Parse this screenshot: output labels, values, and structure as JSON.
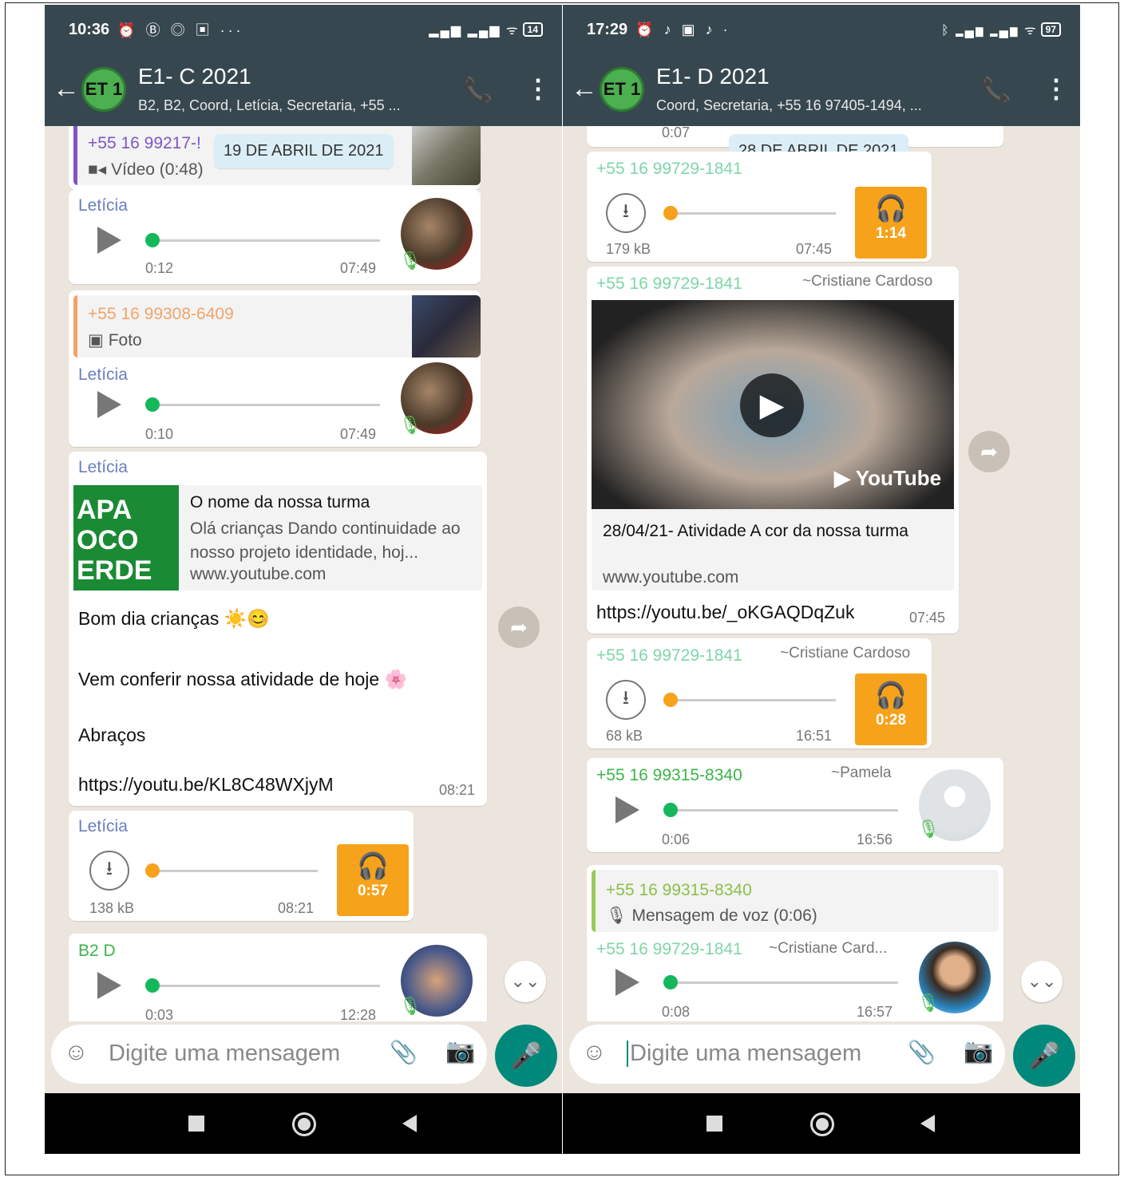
{
  "left": {
    "status": {
      "time": "10:36",
      "icons": "⏰ Ⓑ ◎ ▣ ···",
      "battery": "14"
    },
    "header": {
      "avatar_text": "ET 1",
      "title": "E1- C 2021",
      "subtitle": "B2, B2, Coord, Letícia, Secretaria, +55 ..."
    },
    "date_chip": "19 DE ABRIL DE 2021",
    "msg1": {
      "quote_sender": "+55 16 99217-!",
      "quote_text": "Vídeo (0:48)"
    },
    "voice1": {
      "sender": "Letícia",
      "duration": "0:12",
      "time": "07:49"
    },
    "msg2": {
      "quote_sender": "+55 16 99308-6409",
      "quote_text": "Foto"
    },
    "voice2": {
      "sender": "Letícia",
      "duration": "0:10",
      "time": "07:49"
    },
    "link_msg": {
      "sender": "Letícia",
      "preview_image_text": "APA\nOCO\nERDE",
      "preview_title": "O nome da nossa turma",
      "preview_desc": "Olá crianças Dando continuidade ao nosso projeto identidade, hoj...",
      "preview_domain": "www.youtube.com",
      "line1": "Bom dia crianças ☀️😊",
      "line2": "Vem conferir nossa atividade de hoje 🌸",
      "line3": "Abraços",
      "url": "https://youtu.be/KL8C48WXjyM",
      "time": "08:21"
    },
    "voice3": {
      "sender": "Letícia",
      "size": "138 kB",
      "time": "08:21",
      "duration": "0:57"
    },
    "voice4": {
      "sender": "B2 D",
      "duration": "0:03",
      "time": "12:28"
    },
    "input_placeholder": "Digite uma mensagem"
  },
  "right": {
    "status": {
      "time": "17:29",
      "icons": "⏰ ♪ ▣ ♪ ·",
      "battery": "97"
    },
    "header": {
      "avatar_text": "ET 1",
      "title": "E1- D 2021",
      "subtitle": "Coord, Secretaria, +55 16 97405-1494, ..."
    },
    "date_chip": "28 DE ABRIL DE 2021",
    "top_partial_time": "0:07",
    "voice1": {
      "sender": "+55 16 99729-1841",
      "name": "~Cristiane Cardoso",
      "size": "179 kB",
      "time": "07:45",
      "duration": "1:14"
    },
    "video_msg": {
      "sender": "+55 16 99729-1841",
      "name": "~Cristiane Cardoso",
      "yt_logo": "YouTube",
      "title": "28/04/21- Atividade A cor da nossa turma",
      "domain": "www.youtube.com",
      "url": "https://youtu.be/_oKGAQDqZuk",
      "time": "07:45"
    },
    "voice2": {
      "sender": "+55 16 99729-1841",
      "name": "~Cristiane Cardoso",
      "size": "68 kB",
      "time": "16:51",
      "duration": "0:28"
    },
    "voice3": {
      "sender": "+55 16 99315-8340",
      "name": "~Pamela",
      "duration": "0:06",
      "time": "16:56"
    },
    "reply": {
      "quote_sender": "+55 16 99315-8340",
      "quote_text": "Mensagem de voz (0:06)"
    },
    "voice4": {
      "sender": "+55 16 99729-1841",
      "name": "~Cristiane Card...",
      "duration": "0:08",
      "time": "16:57"
    },
    "input_placeholder": "Digite uma mensagem"
  },
  "colors": {
    "header": "#37474f",
    "accent_green": "#00897b",
    "orange": "#f7a21b",
    "chat_bg": "#ece5dd"
  }
}
